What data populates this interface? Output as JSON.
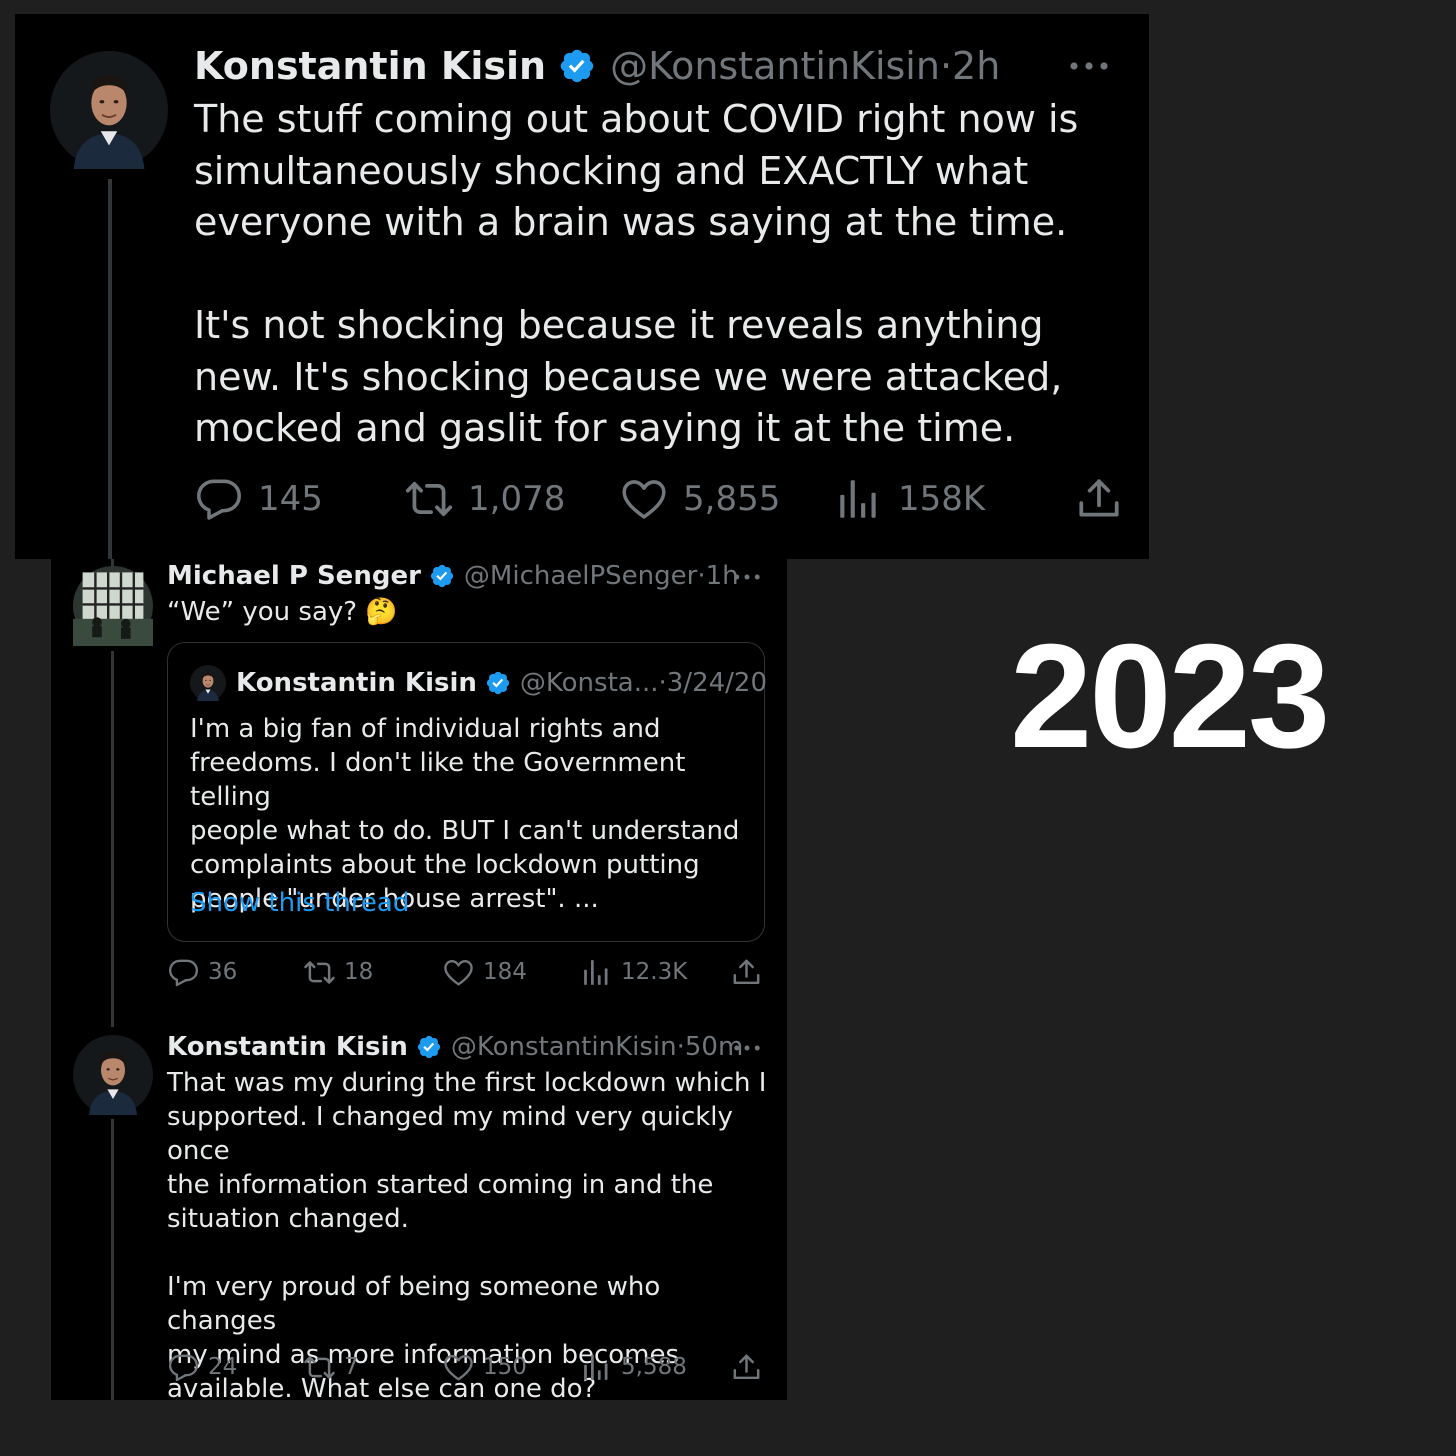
{
  "colors": {
    "background": "#1f1f1f",
    "tweet_bg": "#000000",
    "text": "#e7e9ea",
    "muted": "#71767b",
    "verified": "#1d9bf0",
    "link": "#1d9bf0"
  },
  "tweet1": {
    "name": "Konstantin Kisin",
    "handle": "@KonstantinKisin",
    "separator": "·",
    "time": "2h",
    "text": "The stuff coming out about COVID right now is\nsimultaneously shocking and EXACTLY what\neveryone with a brain was saying at the time.\n\nIt's not shocking because it reveals anything\nnew. It's shocking because we were attacked,\nmocked and gaslit for saying it at the time.",
    "replies": "145",
    "reposts": "1,078",
    "likes": "5,855",
    "views": "158K",
    "icons": [
      "verified-badge-icon",
      "more-icon",
      "reply-icon",
      "repost-icon",
      "like-icon",
      "views-icon",
      "share-icon"
    ]
  },
  "tweet2": {
    "name": "Michael P Senger",
    "handle": "@MichaelPSenger",
    "separator": "·",
    "time": "1h",
    "text": "“We” you say? 🤔",
    "replies": "36",
    "reposts": "18",
    "likes": "184",
    "views": "12.3K",
    "quote": {
      "name": "Konstantin Kisin",
      "handle": "@Konsta...",
      "separator": "·",
      "time": "3/24/20",
      "text": "I'm a big fan of individual rights and\nfreedoms. I don't like the Government telling\npeople what to do. BUT I can't understand\ncomplaints about the lockdown putting\npeople \"under house arrest\". ...",
      "link": "Show this thread"
    }
  },
  "tweet3": {
    "name": "Konstantin Kisin",
    "handle": "@KonstantinKisin",
    "separator": "·",
    "time": "50m",
    "text": "That was my during the first lockdown which I\nsupported. I changed my mind very quickly once\nthe information started coming in and the\nsituation changed.\n\nI'm very proud of being someone who changes\nmy mind as more information becomes\navailable. What else can one do?",
    "replies": "24",
    "reposts": "7",
    "likes": "150",
    "views": "5,588"
  },
  "year_label": "2023"
}
